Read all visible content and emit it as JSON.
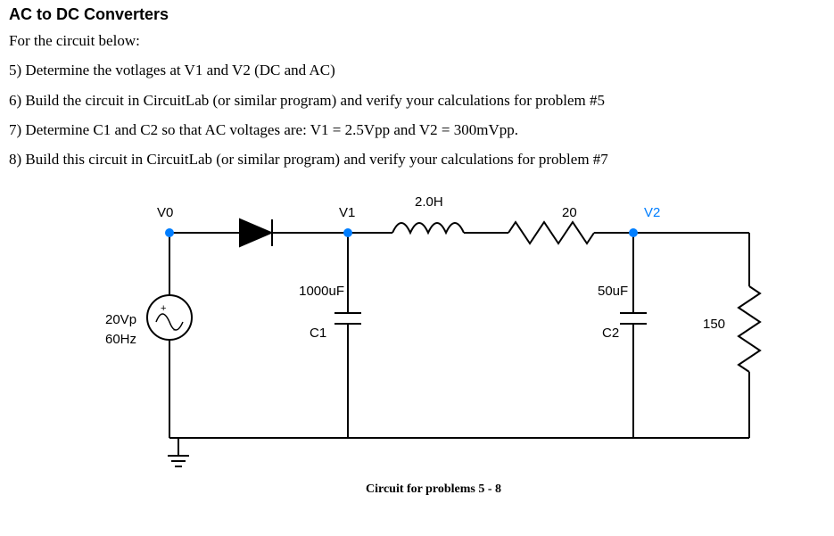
{
  "header": {
    "title": "AC to DC Converters",
    "intro": "For the circuit below:"
  },
  "questions": {
    "q5": "5)  Determine the votlages at V1 and V2 (DC and AC)",
    "q6": "6)  Build the circuit in CircuitLab (or similar program) and verify your calculations for problem #5",
    "q7": "7)  Determine C1 and C2 so that AC voltages are:  V1 = 2.5Vpp and V2 = 300mVpp.",
    "q8": "8)  Build this circuit in CircuitLab (or similar program) and verify your calculations for problem #7"
  },
  "circuit": {
    "caption": "Circuit for problems 5 - 8",
    "source": {
      "peak": "20Vp",
      "freq": "60Hz"
    },
    "nodes": {
      "v0": "V0",
      "v1": "V1",
      "v2": "V2"
    },
    "components": {
      "L": {
        "value": "2.0H"
      },
      "Rs": {
        "value": "20"
      },
      "C1": {
        "name": "C1",
        "value": "1000uF"
      },
      "C2": {
        "name": "C2",
        "value": "50uF"
      },
      "RL": {
        "value": "150"
      }
    },
    "node_color": "#007eff"
  },
  "chart_data": {
    "type": "circuit",
    "description": "AC source feeds diode; filtered by C1 (1000uF), then series 2.0H inductor and 20Ω resistor, then C2 (50uF) in parallel with 150Ω load.",
    "source": {
      "Vpeak": 20,
      "frequency_Hz": 60
    },
    "components": [
      {
        "ref": "D1",
        "type": "diode",
        "from": "V0",
        "to": "V1"
      },
      {
        "ref": "C1",
        "type": "capacitor",
        "value_uF": 1000,
        "from": "V1",
        "to": "GND"
      },
      {
        "ref": "L1",
        "type": "inductor",
        "value_H": 2.0,
        "from": "V1",
        "to": "N1"
      },
      {
        "ref": "R1",
        "type": "resistor",
        "value_ohm": 20,
        "from": "N1",
        "to": "V2"
      },
      {
        "ref": "C2",
        "type": "capacitor",
        "value_uF": 50,
        "from": "V2",
        "to": "GND"
      },
      {
        "ref": "RL",
        "type": "resistor",
        "value_ohm": 150,
        "from": "V2",
        "to": "GND"
      }
    ],
    "nodes": [
      "V0",
      "V1",
      "V2",
      "GND"
    ]
  }
}
